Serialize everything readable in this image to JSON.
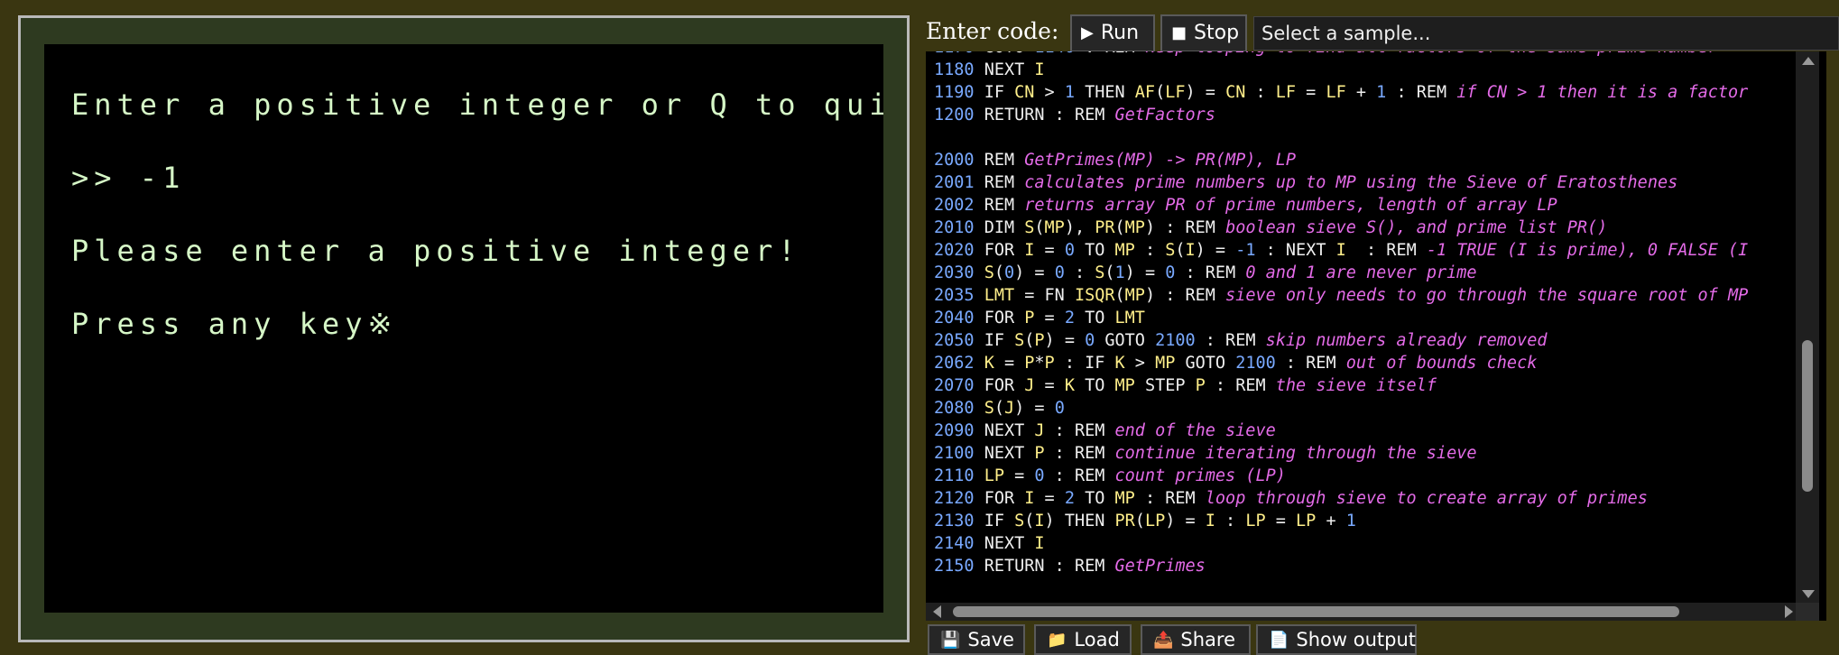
{
  "screen": {
    "lines": [
      "Enter a positive integer or Q to quit",
      ">> -1",
      "Please enter a positive integer!",
      "Press any key※"
    ]
  },
  "toolbar": {
    "enter_code_label": "Enter code:",
    "run_label": "Run",
    "stop_label": "Stop",
    "sample_placeholder": "Select a sample..."
  },
  "code_lines": [
    [
      {
        "t": "1170 ",
        "c": "ln"
      },
      {
        "t": "GOTO ",
        "c": "kw"
      },
      {
        "t": "1140",
        "c": "num"
      },
      {
        "t": " : REM ",
        "c": "kw"
      },
      {
        "t": "keep looping to find all factors of the same prime number",
        "c": "cm"
      }
    ],
    [
      {
        "t": "1180 ",
        "c": "ln"
      },
      {
        "t": "NEXT ",
        "c": "kw"
      },
      {
        "t": "I",
        "c": "var"
      }
    ],
    [
      {
        "t": "1190 ",
        "c": "ln"
      },
      {
        "t": "IF ",
        "c": "kw"
      },
      {
        "t": "CN",
        "c": "var"
      },
      {
        "t": " > ",
        "c": "kw"
      },
      {
        "t": "1",
        "c": "num"
      },
      {
        "t": " THEN ",
        "c": "kw"
      },
      {
        "t": "AF",
        "c": "var"
      },
      {
        "t": "(",
        "c": "kw"
      },
      {
        "t": "LF",
        "c": "var"
      },
      {
        "t": ") = ",
        "c": "kw"
      },
      {
        "t": "CN",
        "c": "var"
      },
      {
        "t": " : ",
        "c": "kw"
      },
      {
        "t": "LF",
        "c": "var"
      },
      {
        "t": " = ",
        "c": "kw"
      },
      {
        "t": "LF",
        "c": "var"
      },
      {
        "t": " + ",
        "c": "kw"
      },
      {
        "t": "1",
        "c": "num"
      },
      {
        "t": " : REM ",
        "c": "kw"
      },
      {
        "t": "if CN > 1 then it is a factor",
        "c": "cm"
      }
    ],
    [
      {
        "t": "1200 ",
        "c": "ln"
      },
      {
        "t": "RETURN : REM ",
        "c": "kw"
      },
      {
        "t": "GetFactors",
        "c": "cm"
      }
    ],
    [],
    [
      {
        "t": "2000 ",
        "c": "ln"
      },
      {
        "t": "REM ",
        "c": "kw"
      },
      {
        "t": "GetPrimes(MP) -> PR(MP), LP",
        "c": "cm"
      }
    ],
    [
      {
        "t": "2001 ",
        "c": "ln"
      },
      {
        "t": "REM ",
        "c": "kw"
      },
      {
        "t": "calculates prime numbers up to MP using the Sieve of Eratosthenes",
        "c": "cm"
      }
    ],
    [
      {
        "t": "2002 ",
        "c": "ln"
      },
      {
        "t": "REM ",
        "c": "kw"
      },
      {
        "t": "returns array PR of prime numbers, length of array LP",
        "c": "cm"
      }
    ],
    [
      {
        "t": "2010 ",
        "c": "ln"
      },
      {
        "t": "DIM ",
        "c": "kw"
      },
      {
        "t": "S",
        "c": "var"
      },
      {
        "t": "(",
        "c": "kw"
      },
      {
        "t": "MP",
        "c": "var"
      },
      {
        "t": "), ",
        "c": "kw"
      },
      {
        "t": "PR",
        "c": "var"
      },
      {
        "t": "(",
        "c": "kw"
      },
      {
        "t": "MP",
        "c": "var"
      },
      {
        "t": ") : REM ",
        "c": "kw"
      },
      {
        "t": "boolean sieve S(), and prime list PR()",
        "c": "cm"
      }
    ],
    [
      {
        "t": "2020 ",
        "c": "ln"
      },
      {
        "t": "FOR ",
        "c": "kw"
      },
      {
        "t": "I",
        "c": "var"
      },
      {
        "t": " = ",
        "c": "kw"
      },
      {
        "t": "0",
        "c": "num"
      },
      {
        "t": " TO ",
        "c": "kw"
      },
      {
        "t": "MP",
        "c": "var"
      },
      {
        "t": " : ",
        "c": "kw"
      },
      {
        "t": "S",
        "c": "var"
      },
      {
        "t": "(",
        "c": "kw"
      },
      {
        "t": "I",
        "c": "var"
      },
      {
        "t": ") = ",
        "c": "kw"
      },
      {
        "t": "-1",
        "c": "num"
      },
      {
        "t": " : NEXT ",
        "c": "kw"
      },
      {
        "t": "I",
        "c": "var"
      },
      {
        "t": "  : REM ",
        "c": "kw"
      },
      {
        "t": "-1 TRUE (I is prime), 0 FALSE (I",
        "c": "cm"
      }
    ],
    [
      {
        "t": "2030 ",
        "c": "ln"
      },
      {
        "t": "S",
        "c": "var"
      },
      {
        "t": "(",
        "c": "kw"
      },
      {
        "t": "0",
        "c": "num"
      },
      {
        "t": ") = ",
        "c": "kw"
      },
      {
        "t": "0",
        "c": "num"
      },
      {
        "t": " : ",
        "c": "kw"
      },
      {
        "t": "S",
        "c": "var"
      },
      {
        "t": "(",
        "c": "kw"
      },
      {
        "t": "1",
        "c": "num"
      },
      {
        "t": ") = ",
        "c": "kw"
      },
      {
        "t": "0",
        "c": "num"
      },
      {
        "t": " : REM ",
        "c": "kw"
      },
      {
        "t": "0 and 1 are never prime",
        "c": "cm"
      }
    ],
    [
      {
        "t": "2035 ",
        "c": "ln"
      },
      {
        "t": "LMT",
        "c": "var"
      },
      {
        "t": " = FN ",
        "c": "kw"
      },
      {
        "t": "ISQR",
        "c": "var"
      },
      {
        "t": "(",
        "c": "kw"
      },
      {
        "t": "MP",
        "c": "var"
      },
      {
        "t": ") : REM ",
        "c": "kw"
      },
      {
        "t": "sieve only needs to go through the square root of MP",
        "c": "cm"
      }
    ],
    [
      {
        "t": "2040 ",
        "c": "ln"
      },
      {
        "t": "FOR ",
        "c": "kw"
      },
      {
        "t": "P",
        "c": "var"
      },
      {
        "t": " = ",
        "c": "kw"
      },
      {
        "t": "2",
        "c": "num"
      },
      {
        "t": " TO ",
        "c": "kw"
      },
      {
        "t": "LMT",
        "c": "var"
      }
    ],
    [
      {
        "t": "2050 ",
        "c": "ln"
      },
      {
        "t": "IF ",
        "c": "kw"
      },
      {
        "t": "S",
        "c": "var"
      },
      {
        "t": "(",
        "c": "kw"
      },
      {
        "t": "P",
        "c": "var"
      },
      {
        "t": ") = ",
        "c": "kw"
      },
      {
        "t": "0",
        "c": "num"
      },
      {
        "t": " GOTO ",
        "c": "kw"
      },
      {
        "t": "2100",
        "c": "num"
      },
      {
        "t": " : REM ",
        "c": "kw"
      },
      {
        "t": "skip numbers already removed",
        "c": "cm"
      }
    ],
    [
      {
        "t": "2062 ",
        "c": "ln"
      },
      {
        "t": "K",
        "c": "var"
      },
      {
        "t": " = ",
        "c": "kw"
      },
      {
        "t": "P",
        "c": "var"
      },
      {
        "t": "*",
        "c": "kw"
      },
      {
        "t": "P",
        "c": "var"
      },
      {
        "t": " : IF ",
        "c": "kw"
      },
      {
        "t": "K",
        "c": "var"
      },
      {
        "t": " > ",
        "c": "kw"
      },
      {
        "t": "MP",
        "c": "var"
      },
      {
        "t": " GOTO ",
        "c": "kw"
      },
      {
        "t": "2100",
        "c": "num"
      },
      {
        "t": " : REM ",
        "c": "kw"
      },
      {
        "t": "out of bounds check",
        "c": "cm"
      }
    ],
    [
      {
        "t": "2070 ",
        "c": "ln"
      },
      {
        "t": "FOR ",
        "c": "kw"
      },
      {
        "t": "J",
        "c": "var"
      },
      {
        "t": " = ",
        "c": "kw"
      },
      {
        "t": "K",
        "c": "var"
      },
      {
        "t": " TO ",
        "c": "kw"
      },
      {
        "t": "MP",
        "c": "var"
      },
      {
        "t": " STEP ",
        "c": "kw"
      },
      {
        "t": "P",
        "c": "var"
      },
      {
        "t": " : REM ",
        "c": "kw"
      },
      {
        "t": "the sieve itself",
        "c": "cm"
      }
    ],
    [
      {
        "t": "2080 ",
        "c": "ln"
      },
      {
        "t": "S",
        "c": "var"
      },
      {
        "t": "(",
        "c": "kw"
      },
      {
        "t": "J",
        "c": "var"
      },
      {
        "t": ") = ",
        "c": "kw"
      },
      {
        "t": "0",
        "c": "num"
      }
    ],
    [
      {
        "t": "2090 ",
        "c": "ln"
      },
      {
        "t": "NEXT ",
        "c": "kw"
      },
      {
        "t": "J",
        "c": "var"
      },
      {
        "t": " : REM ",
        "c": "kw"
      },
      {
        "t": "end of the sieve",
        "c": "cm"
      }
    ],
    [
      {
        "t": "2100 ",
        "c": "ln"
      },
      {
        "t": "NEXT ",
        "c": "kw"
      },
      {
        "t": "P",
        "c": "var"
      },
      {
        "t": " : REM ",
        "c": "kw"
      },
      {
        "t": "continue iterating through the sieve",
        "c": "cm"
      }
    ],
    [
      {
        "t": "2110 ",
        "c": "ln"
      },
      {
        "t": "LP",
        "c": "var"
      },
      {
        "t": " = ",
        "c": "kw"
      },
      {
        "t": "0",
        "c": "num"
      },
      {
        "t": " : REM ",
        "c": "kw"
      },
      {
        "t": "count primes (LP)",
        "c": "cm"
      }
    ],
    [
      {
        "t": "2120 ",
        "c": "ln"
      },
      {
        "t": "FOR ",
        "c": "kw"
      },
      {
        "t": "I",
        "c": "var"
      },
      {
        "t": " = ",
        "c": "kw"
      },
      {
        "t": "2",
        "c": "num"
      },
      {
        "t": " TO ",
        "c": "kw"
      },
      {
        "t": "MP",
        "c": "var"
      },
      {
        "t": " : REM ",
        "c": "kw"
      },
      {
        "t": "loop through sieve to create array of primes",
        "c": "cm"
      }
    ],
    [
      {
        "t": "2130 ",
        "c": "ln"
      },
      {
        "t": "IF ",
        "c": "kw"
      },
      {
        "t": "S",
        "c": "var"
      },
      {
        "t": "(",
        "c": "kw"
      },
      {
        "t": "I",
        "c": "var"
      },
      {
        "t": ") THEN ",
        "c": "kw"
      },
      {
        "t": "PR",
        "c": "var"
      },
      {
        "t": "(",
        "c": "kw"
      },
      {
        "t": "LP",
        "c": "var"
      },
      {
        "t": ") = ",
        "c": "kw"
      },
      {
        "t": "I",
        "c": "var"
      },
      {
        "t": " : ",
        "c": "kw"
      },
      {
        "t": "LP",
        "c": "var"
      },
      {
        "t": " = ",
        "c": "kw"
      },
      {
        "t": "LP",
        "c": "var"
      },
      {
        "t": " + ",
        "c": "kw"
      },
      {
        "t": "1",
        "c": "num"
      }
    ],
    [
      {
        "t": "2140 ",
        "c": "ln"
      },
      {
        "t": "NEXT ",
        "c": "kw"
      },
      {
        "t": "I",
        "c": "var"
      }
    ],
    [
      {
        "t": "2150 ",
        "c": "ln"
      },
      {
        "t": "RETURN : REM ",
        "c": "kw"
      },
      {
        "t": "GetPrimes",
        "c": "cm"
      }
    ]
  ],
  "bottom_buttons": {
    "save_label": "Save",
    "load_label": "Load",
    "share_label": "Share",
    "show_output_label": "Show output"
  },
  "colors": {
    "line_number": "#79a9ff",
    "keyword": "#f0f0f0",
    "variable": "#ffef8a",
    "comment": "#e46be8",
    "screen_text": "#d6f7c7"
  },
  "icons": [
    "play-icon",
    "stop-icon",
    "save-icon",
    "folder-icon",
    "share-icon",
    "document-icon"
  ]
}
